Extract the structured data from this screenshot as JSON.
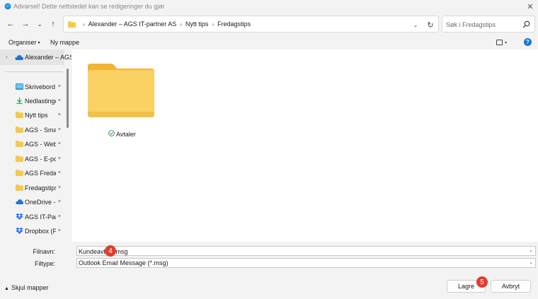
{
  "window": {
    "title": "Advarsel! Dette nettstedet kan se redigeringer du gjør",
    "app_icon": "edge-browser-icon",
    "close_icon": "✕"
  },
  "nav": {
    "back_icon": "←",
    "forward_icon": "→",
    "recent_icon": "⌄",
    "up_icon": "↑",
    "breadcrumb": [
      "Alexander – AGS IT-partner AS",
      "Nytt tips",
      "Fredagstips"
    ],
    "breadcrumb_sep": "›",
    "dropdown_icon": "⌄",
    "refresh_icon": "↻",
    "search_placeholder": "Søk i Fredagstips"
  },
  "toolbar": {
    "organize_label": "Organiser",
    "organize_caret": "▾",
    "new_folder_label": "Ny mappe",
    "view_caret": "▾",
    "help_label": "?"
  },
  "sidebar": {
    "top_chevron": "›",
    "top_label": "Alexander – AGS",
    "pin_glyph": "✦",
    "items": [
      {
        "label": "Skrivebord",
        "icon": "desktop-icon"
      },
      {
        "label": "Nedlastinger",
        "icon": "download-icon"
      },
      {
        "label": "Nytt tips",
        "icon": "folder-icon"
      },
      {
        "label": "AGS - Smart",
        "icon": "folder-icon"
      },
      {
        "label": "AGS - Webina",
        "icon": "folder-icon"
      },
      {
        "label": "AGS - E-post",
        "icon": "folder-icon"
      },
      {
        "label": "AGS Fredagst",
        "icon": "folder-icon"
      },
      {
        "label": "Fredagstipset",
        "icon": "folder-icon"
      },
      {
        "label": "OneDrive - A",
        "icon": "onedrive-icon"
      },
      {
        "label": "AGS IT-Partne",
        "icon": "dropbox-icon"
      },
      {
        "label": "Dropbox (Priv",
        "icon": "dropbox-icon"
      }
    ]
  },
  "content": {
    "items": [
      {
        "name": "Avtaler",
        "type": "folder",
        "sync_status": "synced"
      }
    ]
  },
  "form": {
    "filename_label": "Filnavn:",
    "filename_value": "Kundeavtale.msg",
    "filetype_label": "Filtype:",
    "filetype_value": "Outlook Email Message (*.msg)",
    "dropdown_caret": "⌄"
  },
  "footer": {
    "hide_folders_caret": "▲",
    "hide_folders_label": "Skjul mapper",
    "save_label": "Lagre",
    "cancel_label": "Avbryt"
  },
  "annotations": {
    "step_filename": "4",
    "step_save": "5",
    "badge_color": "#e23c2e"
  },
  "colors": {
    "accent": "#1a73d8",
    "folder_yellow": "#f7c948"
  }
}
